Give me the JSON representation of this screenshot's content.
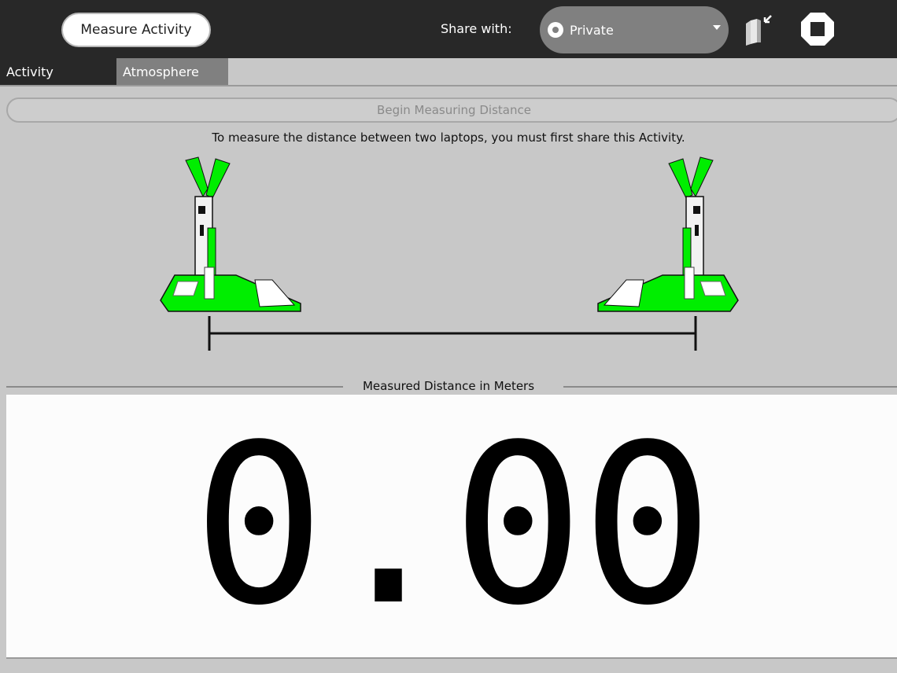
{
  "toolbar": {
    "activity_name": "Measure Activity",
    "share_label": "Share with:",
    "share_value": "Private",
    "keep_icon": "keep-journal-icon",
    "stop_icon": "stop-icon"
  },
  "tabs": [
    {
      "label": "Activity",
      "selected": true
    },
    {
      "label": "Atmosphere",
      "selected": false
    }
  ],
  "main": {
    "begin_button_label": "Begin Measuring Distance",
    "instruction": "To measure the distance between two laptops, you must first share this Activity.",
    "illustration_icons": [
      "laptop-left-icon",
      "laptop-right-icon",
      "distance-bar-icon"
    ],
    "distance_frame_title": "Measured Distance in Meters",
    "distance_value": "0.00"
  },
  "colors": {
    "toolbar_bg": "#282828",
    "xo_green": "#00ee00",
    "panel_bg": "#c8c8c8"
  }
}
